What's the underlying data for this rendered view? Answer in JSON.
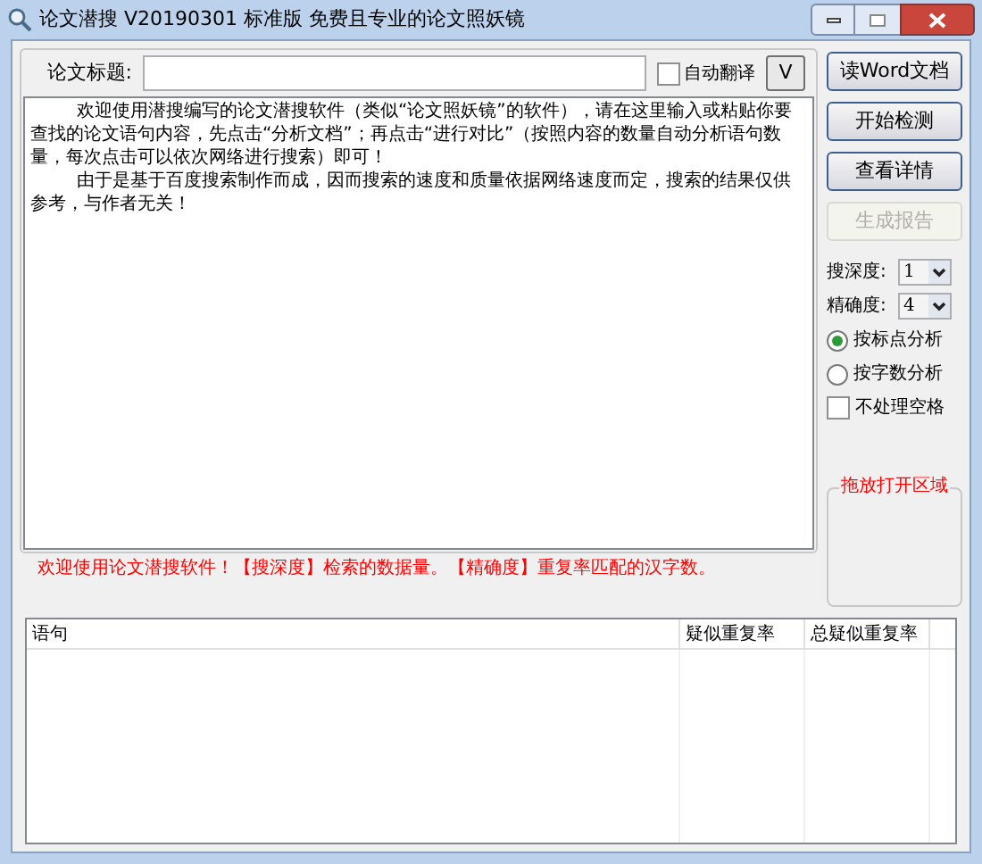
{
  "window": {
    "title": "论文潜搜 V20190301 标准版 免费且专业的论文照妖镜"
  },
  "title_field": {
    "label": "论文标题:"
  },
  "auto_translate": {
    "label": "自动翻译",
    "checked": false
  },
  "dropdown_button": {
    "label": "V"
  },
  "text_area": {
    "paragraphs": [
      "欢迎使用潜搜编写的论文潜搜软件（类似“论文照妖镜”的软件），请在这里输入或粘贴你要查找的论文语句内容，先点击“分析文档”；再点击“进行对比”（按照内容的数量自动分析语句数量，每次点击可以依次网络进行搜索）即可！",
      "由于是基于百度搜索制作而成，因而搜索的速度和质量依据网络速度而定，搜索的结果仅供参考，与作者无关！"
    ]
  },
  "buttons": [
    {
      "label": "读Word文档",
      "disabled": false
    },
    {
      "label": "开始检测",
      "disabled": false
    },
    {
      "label": "查看详情",
      "disabled": false
    },
    {
      "label": "生成报告",
      "disabled": true
    }
  ],
  "selects": [
    {
      "label": "搜深度:",
      "value": "1"
    },
    {
      "label": "精确度:",
      "value": "4"
    }
  ],
  "radios": [
    {
      "label": "按标点分析",
      "selected": true
    },
    {
      "label": "按字数分析",
      "selected": false
    }
  ],
  "ignore_spaces": {
    "label": "不处理空格",
    "checked": false
  },
  "drop_area": {
    "title": "拖放打开区域"
  },
  "hint": "欢迎使用论文潜搜软件！【搜深度】检索的数据量。【精确度】重复率匹配的汉字数。",
  "table": {
    "columns": [
      "语句",
      "疑似重复率",
      "总疑似重复率"
    ]
  }
}
